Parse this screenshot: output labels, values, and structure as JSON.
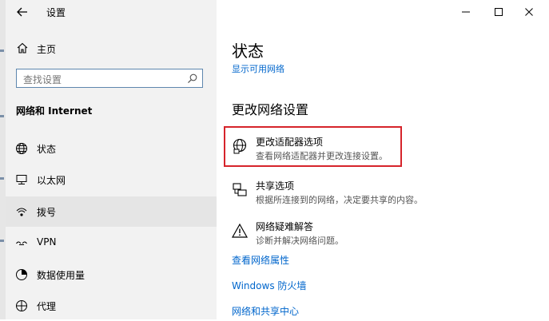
{
  "window": {
    "title": "设置"
  },
  "sidebar": {
    "home_label": "主页",
    "search_placeholder": "查找设置",
    "section_title": "网络和 Internet",
    "items": [
      {
        "label": "状态",
        "icon": "globe-icon"
      },
      {
        "label": "以太网",
        "icon": "ethernet-icon"
      },
      {
        "label": "拨号",
        "icon": "dialup-icon"
      },
      {
        "label": "VPN",
        "icon": "vpn-icon"
      },
      {
        "label": "数据使用量",
        "icon": "data-usage-icon"
      },
      {
        "label": "代理",
        "icon": "proxy-icon"
      }
    ]
  },
  "main": {
    "title": "状态",
    "show_networks_link": "显示可用网络",
    "section_title": "更改网络设置",
    "options": [
      {
        "title": "更改适配器选项",
        "desc": "查看网络适配器并更改连接设置。",
        "icon": "adapter-icon"
      },
      {
        "title": "共享选项",
        "desc": "根据所连接到的网络，决定要共享的内容。",
        "icon": "sharing-icon"
      },
      {
        "title": "网络疑难解答",
        "desc": "诊断并解决网络问题。",
        "icon": "warning-icon"
      }
    ],
    "links": [
      "查看网络属性",
      "Windows 防火墙",
      "网络和共享中心"
    ]
  },
  "colors": {
    "link": "#0066cc",
    "highlight_border": "#d6242b",
    "sidebar_bg": "#f2f2f2",
    "selected_bg": "#e5e5e5"
  }
}
